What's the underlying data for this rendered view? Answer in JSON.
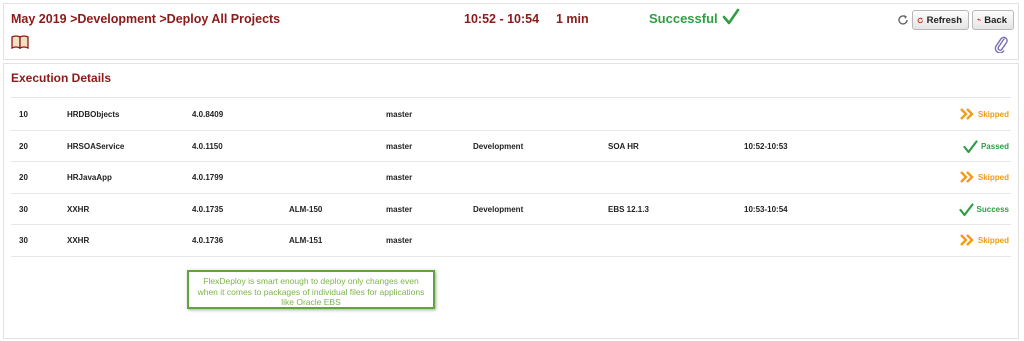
{
  "header": {
    "breadcrumb": [
      "May 2019",
      ">Development",
      ">Deploy All Projects"
    ],
    "time_range": "10:52 - 10:54",
    "duration": "1 min",
    "status": "Successful",
    "status_color": "#2f9e44",
    "refresh_label": "Refresh",
    "back_label": "Back"
  },
  "details": {
    "title": "Execution Details",
    "rows": [
      {
        "seq": "10",
        "project": "HRDBObjects",
        "version": "4.0.8409",
        "ticket": "",
        "branch": "master",
        "environment": "",
        "target": "",
        "time": "",
        "status": "Skipped",
        "status_type": "skipped"
      },
      {
        "seq": "20",
        "project": "HRSOAService",
        "version": "4.0.1150",
        "ticket": "",
        "branch": "master",
        "environment": "Development",
        "target": "SOA HR",
        "time": "10:52-10:53",
        "status": "Passed",
        "status_type": "passed"
      },
      {
        "seq": "20",
        "project": "HRJavaApp",
        "version": "4.0.1799",
        "ticket": "",
        "branch": "master",
        "environment": "",
        "target": "",
        "time": "",
        "status": "Skipped",
        "status_type": "skipped"
      },
      {
        "seq": "30",
        "project": "XXHR",
        "version": "4.0.1735",
        "ticket": "ALM-150",
        "branch": "master",
        "environment": "Development",
        "target": "EBS 12.1.3",
        "time": "10:53-10:54",
        "status": "Success",
        "status_type": "passed"
      },
      {
        "seq": "30",
        "project": "XXHR",
        "version": "4.0.1736",
        "ticket": "ALM-151",
        "branch": "master",
        "environment": "",
        "target": "",
        "time": "",
        "status": "Skipped",
        "status_type": "skipped"
      }
    ]
  },
  "callout": {
    "text": "FlexDeploy is smart enough to deploy only changes even when it comes to packages of individual files for applications like Oracle EBS"
  },
  "colors": {
    "title": "#8b1a1a",
    "skipped": "#f29b17",
    "passed": "#2f9e44",
    "callout_border": "#5ea53a"
  }
}
